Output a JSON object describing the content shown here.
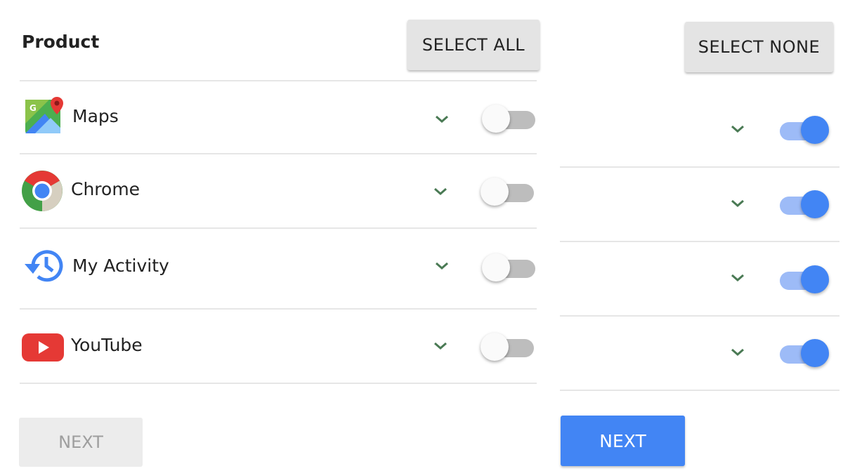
{
  "left_panel": {
    "heading": "Product",
    "select_all_label": "SELECT ALL",
    "next_label": "NEXT",
    "next_enabled": false,
    "products": [
      {
        "name": "Maps",
        "icon": "google-maps-icon",
        "enabled": false
      },
      {
        "name": "Chrome",
        "icon": "chrome-icon",
        "enabled": false
      },
      {
        "name": "My Activity",
        "icon": "my-activity-icon",
        "enabled": false
      },
      {
        "name": "YouTube",
        "icon": "youtube-icon",
        "enabled": false
      }
    ]
  },
  "right_panel": {
    "select_none_label": "SELECT NONE",
    "next_label": "NEXT",
    "next_enabled": true,
    "toggles": [
      {
        "enabled": true
      },
      {
        "enabled": true
      },
      {
        "enabled": true
      },
      {
        "enabled": true
      }
    ]
  },
  "colors": {
    "accent": "#4285f4",
    "toggle_on_track": "#9dbbf7",
    "toggle_off_track": "#bdbdbd",
    "chevron": "#4a7a54"
  }
}
